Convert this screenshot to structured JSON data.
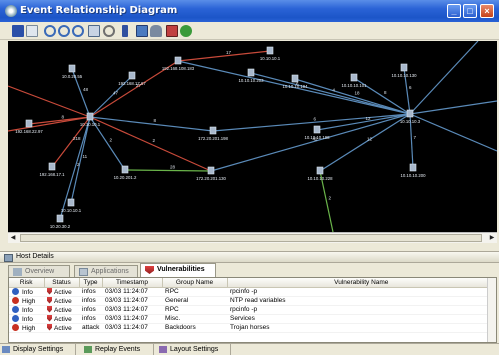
{
  "window": {
    "title": "Event Relationship Diagram"
  },
  "toolbar": {
    "icons": [
      "save-icon",
      "print-preview-icon",
      "zoom-in-icon",
      "zoom-out-icon",
      "zoom-fit-icon",
      "zoom-box-icon",
      "select-icon",
      "filter-icon",
      "layout-icon",
      "user-icon",
      "export-icon",
      "refresh-icon"
    ]
  },
  "graph": {
    "nodes": [
      {
        "id": "n1",
        "label": "10.0.20.55"
      },
      {
        "id": "n2",
        "label": "192.168.17.67"
      },
      {
        "id": "n3",
        "label": "192.168.108.183"
      },
      {
        "id": "n4",
        "label": "10.10.10.1"
      },
      {
        "id": "n5",
        "label": "10.10.10.203"
      },
      {
        "id": "n6",
        "label": "10.10.10.194"
      },
      {
        "id": "n7",
        "label": "10.10.10.101"
      },
      {
        "id": "n8",
        "label": "10.10.10.130"
      },
      {
        "id": "n9",
        "label": "10.10.10.3"
      },
      {
        "id": "n10",
        "label": "192.168.22.97"
      },
      {
        "id": "n11",
        "label": "10.10.10.1"
      },
      {
        "id": "n12",
        "label": "172.20.201.198"
      },
      {
        "id": "n13",
        "label": "10.10.10.198"
      },
      {
        "id": "n14",
        "label": "192.168.17.1"
      },
      {
        "id": "n15",
        "label": "10.20.201.2"
      },
      {
        "id": "n16",
        "label": "172.20.201.130"
      },
      {
        "id": "n17",
        "label": "10.10.10.228"
      },
      {
        "id": "n18",
        "label": "10.10.10.200"
      },
      {
        "id": "n19",
        "label": "10.10.10.1"
      },
      {
        "id": "n20",
        "label": "10.20.30.2"
      }
    ],
    "edge_labels": [
      "48",
      "47",
      "27",
      "17",
      "4",
      "6",
      "18",
      "8",
      "6",
      "8",
      "8",
      "218",
      "2",
      "2",
      "6",
      "12",
      "42",
      "12",
      "7",
      "11",
      "2",
      "28",
      "2"
    ]
  },
  "host_details": {
    "label": "Host Details"
  },
  "tabs": [
    {
      "label": "Overview",
      "icon": "overview-icon",
      "active": false
    },
    {
      "label": "Applications",
      "icon": "applications-icon",
      "active": false
    },
    {
      "label": "Vulnerabilities",
      "icon": "vulnerabilities-icon",
      "active": true
    }
  ],
  "table": {
    "columns": [
      "Risk",
      "Status",
      "Type",
      "Timestamp",
      "Group Name",
      "Vulnerability Name"
    ],
    "rows": [
      {
        "risk": "Info",
        "risk_color": "#3060c0",
        "status": "Active",
        "type": "infos",
        "timestamp": "03/03 11:24:07",
        "group": "RPC",
        "vuln": "rpcinfo -p"
      },
      {
        "risk": "High",
        "risk_color": "#c83020",
        "status": "Active",
        "type": "infos",
        "timestamp": "03/03 11:24:07",
        "group": "General",
        "vuln": "NTP read variables"
      },
      {
        "risk": "Info",
        "risk_color": "#3060c0",
        "status": "Active",
        "type": "infos",
        "timestamp": "03/03 11:24:07",
        "group": "RPC",
        "vuln": "rpcinfo -p"
      },
      {
        "risk": "Info",
        "risk_color": "#3060c0",
        "status": "Active",
        "type": "infos",
        "timestamp": "03/03 11:24:07",
        "group": "Misc.",
        "vuln": "Services"
      },
      {
        "risk": "High",
        "risk_color": "#c83020",
        "status": "Active",
        "type": "attack",
        "timestamp": "03/03 11:24:07",
        "group": "Backdoors",
        "vuln": "Trojan horses"
      }
    ]
  },
  "bottom_tabs": [
    {
      "label": "Display Settings",
      "icon": "display-settings-icon"
    },
    {
      "label": "Replay Events",
      "icon": "replay-icon"
    },
    {
      "label": "Layout Settings",
      "icon": "layout-settings-icon"
    }
  ]
}
